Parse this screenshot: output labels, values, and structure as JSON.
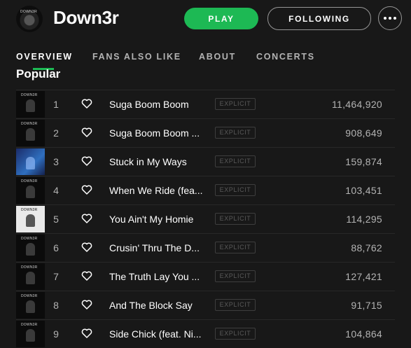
{
  "artist": {
    "name": "Down3r",
    "avatar_tag": "DOWN3R"
  },
  "actions": {
    "play_label": "PLAY",
    "follow_label": "FOLLOWING",
    "more_icon": "more-horizontal-icon"
  },
  "tabs": [
    {
      "label": "OVERVIEW",
      "active": true
    },
    {
      "label": "FANS ALSO LIKE",
      "active": false
    },
    {
      "label": "ABOUT",
      "active": false
    },
    {
      "label": "CONCERTS",
      "active": false
    }
  ],
  "section": {
    "title": "Popular"
  },
  "tracks": [
    {
      "num": "1",
      "title": "Suga Boom Boom",
      "explicit": "EXPLICIT",
      "plays": "11,464,920",
      "art": "dark",
      "cap": "DOWN3R"
    },
    {
      "num": "2",
      "title": "Suga Boom Boom ...",
      "explicit": "EXPLICIT",
      "plays": "908,649",
      "art": "dark",
      "cap": "DOWN3R"
    },
    {
      "num": "3",
      "title": "Stuck in My Ways",
      "explicit": "EXPLICIT",
      "plays": "159,874",
      "art": "blue",
      "cap": ""
    },
    {
      "num": "4",
      "title": "When We Ride (fea...",
      "explicit": "EXPLICIT",
      "plays": "103,451",
      "art": "dark",
      "cap": "DOWN3R"
    },
    {
      "num": "5",
      "title": "You Ain't My Homie",
      "explicit": "EXPLICIT",
      "plays": "114,295",
      "art": "white",
      "cap": "DOWN3R"
    },
    {
      "num": "6",
      "title": "Crusin' Thru The D...",
      "explicit": "EXPLICIT",
      "plays": "88,762",
      "art": "dark",
      "cap": "DOWN3R"
    },
    {
      "num": "7",
      "title": "The Truth Lay You ...",
      "explicit": "EXPLICIT",
      "plays": "127,421",
      "art": "dark",
      "cap": "DOWN3R"
    },
    {
      "num": "8",
      "title": "And The Block Say",
      "explicit": "EXPLICIT",
      "plays": "91,715",
      "art": "dark",
      "cap": "DOWN3R"
    },
    {
      "num": "9",
      "title": "Side Chick (feat. Ni...",
      "explicit": "EXPLICIT",
      "plays": "104,864",
      "art": "dark",
      "cap": "DOWN3R"
    }
  ],
  "colors": {
    "background": "#181818",
    "accent": "#1db954",
    "muted_text": "#b3b3b3"
  }
}
